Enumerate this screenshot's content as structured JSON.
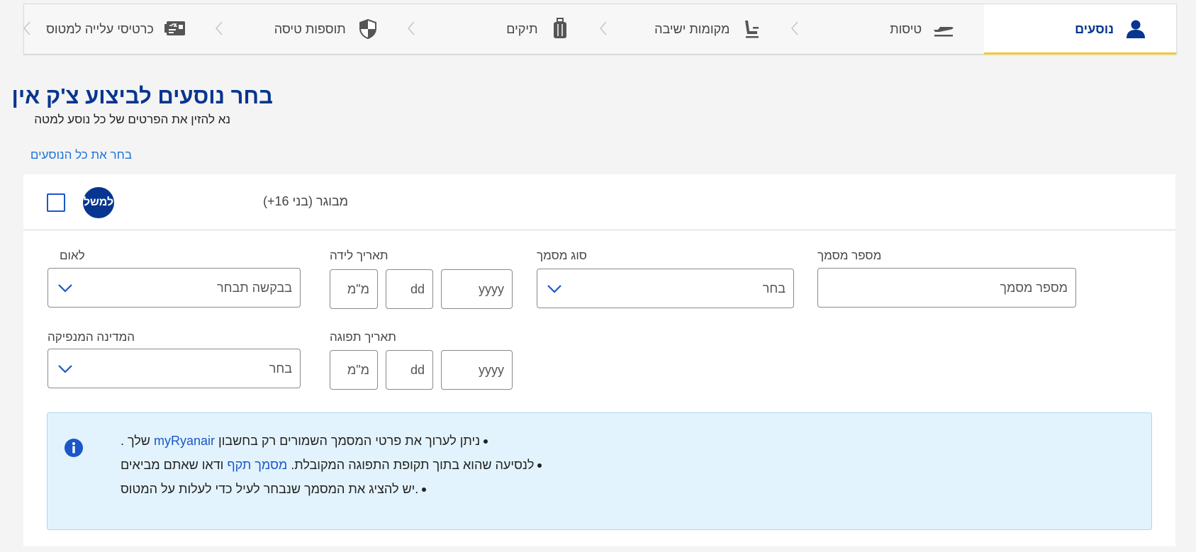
{
  "steps": [
    {
      "label": "נוסעים",
      "icon": "person-icon",
      "active": true
    },
    {
      "label": "טיסות",
      "icon": "plane-icon",
      "active": false
    },
    {
      "label": "מקומות ישיבה",
      "icon": "seat-icon",
      "active": false
    },
    {
      "label": "תיקים",
      "icon": "suitcase-icon",
      "active": false
    },
    {
      "label": "תוספות טיסה",
      "icon": "shield-icon",
      "active": false
    },
    {
      "label": "כרטיסי עלייה למטוס",
      "icon": "boarding-pass-icon",
      "active": false
    }
  ],
  "header": {
    "title": "בחר נוסעים לביצוע צ'ק אין",
    "subtitle": "נא להזין את הפרטים של כל נוסע למטה",
    "select_all": "בחר את כל הנוסעים"
  },
  "passenger": {
    "type_label": "מבוגר (בני 16+)",
    "avatar_text": "למשל",
    "selected": false
  },
  "form": {
    "document_number": {
      "label": "מספר מסמך",
      "placeholder": "מספר מסמך"
    },
    "document_type": {
      "label": "סוג מסמך",
      "value": "בחר"
    },
    "date_of_birth": {
      "label": "תאריך לידה",
      "year": "yyyy",
      "day": "dd",
      "month": "מ\"מ"
    },
    "nationality": {
      "label": "לאום",
      "value": "בבקשה תבחר"
    },
    "expiry_date": {
      "label": "תאריך תפוגה",
      "year": "yyyy",
      "day": "dd",
      "month": "מ\"מ"
    },
    "issuing_country": {
      "label": "המדינה המנפיקה",
      "value": "בחר"
    }
  },
  "info": {
    "line1_prefix": ". שלך",
    "line1_link": "myRyanair",
    "line1_suffix": "ניתן לערוך את פרטי המסמך השמורים רק בחשבון",
    "line2_prefix": "ודאו שאתם מביאים",
    "line2_link": "מסמך תקף",
    "line2_suffix": "לנסיעה שהוא בתוך תקופת התפוגה המקובלת.",
    "line3": "יש להציג את המסמך שנבחר לעיל כדי לעלות על המטוס."
  },
  "colors": {
    "brand_blue": "#073590",
    "link_blue": "#1a73d9",
    "accent_yellow": "#f1c933",
    "info_bg": "#e2f3fd"
  }
}
